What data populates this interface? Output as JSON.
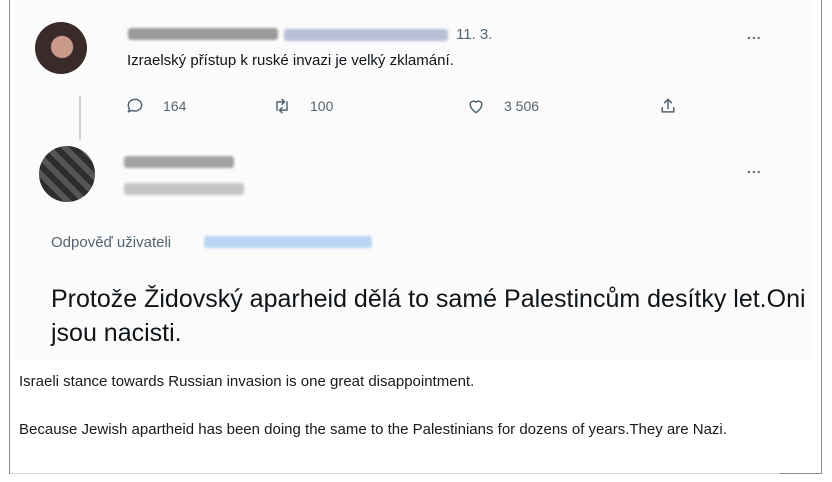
{
  "original_tweet": {
    "date": "11. 3.",
    "text": "Izraelský přístup k ruské invazi je velký zklamání.",
    "replies": "164",
    "retweets": "100",
    "likes": "3 506",
    "more_label": "..."
  },
  "reply_tweet": {
    "more_label": "...",
    "reply_to_label": "Odpověď uživateli",
    "text": "Protože Židovský aparheid dělá to samé Palestincům desítky let.Oni jsou nacisti."
  },
  "translations": {
    "first": "Israeli stance towards Russian invasion is one great disappointment.",
    "second": "Because Jewish apartheid has been doing the same to the Palestinians for dozens of years.They are Nazi."
  },
  "icons": {
    "reply": "speech-bubble-icon",
    "retweet": "retweet-arrows-icon",
    "like": "heart-icon",
    "share": "share-upload-icon"
  },
  "colors": {
    "secondary_text": "#536471",
    "primary_text": "#0f1419"
  }
}
